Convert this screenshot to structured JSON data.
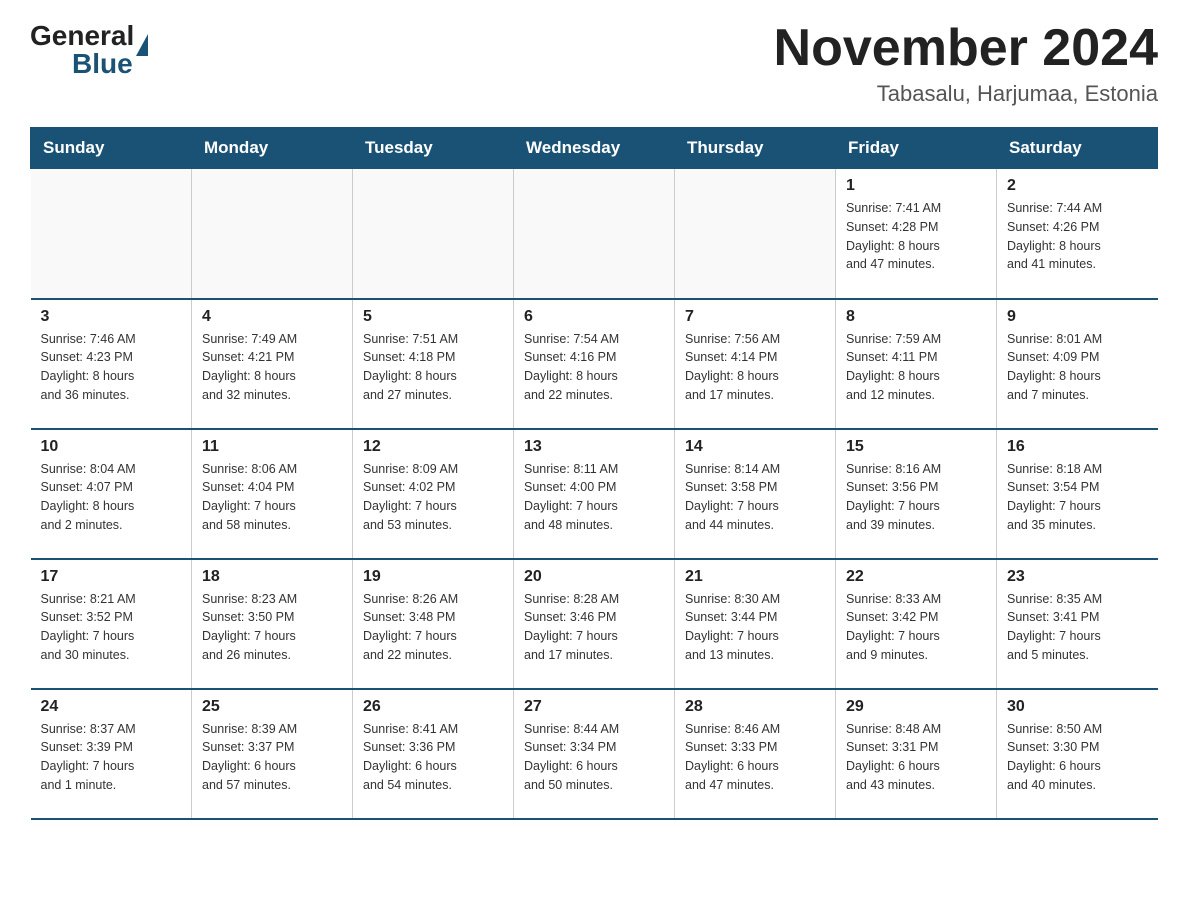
{
  "logo": {
    "text_general": "General",
    "text_blue": "Blue"
  },
  "title": "November 2024",
  "subtitle": "Tabasalu, Harjumaa, Estonia",
  "days_of_week": [
    "Sunday",
    "Monday",
    "Tuesday",
    "Wednesday",
    "Thursday",
    "Friday",
    "Saturday"
  ],
  "weeks": [
    [
      {
        "num": "",
        "info": ""
      },
      {
        "num": "",
        "info": ""
      },
      {
        "num": "",
        "info": ""
      },
      {
        "num": "",
        "info": ""
      },
      {
        "num": "",
        "info": ""
      },
      {
        "num": "1",
        "info": "Sunrise: 7:41 AM\nSunset: 4:28 PM\nDaylight: 8 hours\nand 47 minutes."
      },
      {
        "num": "2",
        "info": "Sunrise: 7:44 AM\nSunset: 4:26 PM\nDaylight: 8 hours\nand 41 minutes."
      }
    ],
    [
      {
        "num": "3",
        "info": "Sunrise: 7:46 AM\nSunset: 4:23 PM\nDaylight: 8 hours\nand 36 minutes."
      },
      {
        "num": "4",
        "info": "Sunrise: 7:49 AM\nSunset: 4:21 PM\nDaylight: 8 hours\nand 32 minutes."
      },
      {
        "num": "5",
        "info": "Sunrise: 7:51 AM\nSunset: 4:18 PM\nDaylight: 8 hours\nand 27 minutes."
      },
      {
        "num": "6",
        "info": "Sunrise: 7:54 AM\nSunset: 4:16 PM\nDaylight: 8 hours\nand 22 minutes."
      },
      {
        "num": "7",
        "info": "Sunrise: 7:56 AM\nSunset: 4:14 PM\nDaylight: 8 hours\nand 17 minutes."
      },
      {
        "num": "8",
        "info": "Sunrise: 7:59 AM\nSunset: 4:11 PM\nDaylight: 8 hours\nand 12 minutes."
      },
      {
        "num": "9",
        "info": "Sunrise: 8:01 AM\nSunset: 4:09 PM\nDaylight: 8 hours\nand 7 minutes."
      }
    ],
    [
      {
        "num": "10",
        "info": "Sunrise: 8:04 AM\nSunset: 4:07 PM\nDaylight: 8 hours\nand 2 minutes."
      },
      {
        "num": "11",
        "info": "Sunrise: 8:06 AM\nSunset: 4:04 PM\nDaylight: 7 hours\nand 58 minutes."
      },
      {
        "num": "12",
        "info": "Sunrise: 8:09 AM\nSunset: 4:02 PM\nDaylight: 7 hours\nand 53 minutes."
      },
      {
        "num": "13",
        "info": "Sunrise: 8:11 AM\nSunset: 4:00 PM\nDaylight: 7 hours\nand 48 minutes."
      },
      {
        "num": "14",
        "info": "Sunrise: 8:14 AM\nSunset: 3:58 PM\nDaylight: 7 hours\nand 44 minutes."
      },
      {
        "num": "15",
        "info": "Sunrise: 8:16 AM\nSunset: 3:56 PM\nDaylight: 7 hours\nand 39 minutes."
      },
      {
        "num": "16",
        "info": "Sunrise: 8:18 AM\nSunset: 3:54 PM\nDaylight: 7 hours\nand 35 minutes."
      }
    ],
    [
      {
        "num": "17",
        "info": "Sunrise: 8:21 AM\nSunset: 3:52 PM\nDaylight: 7 hours\nand 30 minutes."
      },
      {
        "num": "18",
        "info": "Sunrise: 8:23 AM\nSunset: 3:50 PM\nDaylight: 7 hours\nand 26 minutes."
      },
      {
        "num": "19",
        "info": "Sunrise: 8:26 AM\nSunset: 3:48 PM\nDaylight: 7 hours\nand 22 minutes."
      },
      {
        "num": "20",
        "info": "Sunrise: 8:28 AM\nSunset: 3:46 PM\nDaylight: 7 hours\nand 17 minutes."
      },
      {
        "num": "21",
        "info": "Sunrise: 8:30 AM\nSunset: 3:44 PM\nDaylight: 7 hours\nand 13 minutes."
      },
      {
        "num": "22",
        "info": "Sunrise: 8:33 AM\nSunset: 3:42 PM\nDaylight: 7 hours\nand 9 minutes."
      },
      {
        "num": "23",
        "info": "Sunrise: 8:35 AM\nSunset: 3:41 PM\nDaylight: 7 hours\nand 5 minutes."
      }
    ],
    [
      {
        "num": "24",
        "info": "Sunrise: 8:37 AM\nSunset: 3:39 PM\nDaylight: 7 hours\nand 1 minute."
      },
      {
        "num": "25",
        "info": "Sunrise: 8:39 AM\nSunset: 3:37 PM\nDaylight: 6 hours\nand 57 minutes."
      },
      {
        "num": "26",
        "info": "Sunrise: 8:41 AM\nSunset: 3:36 PM\nDaylight: 6 hours\nand 54 minutes."
      },
      {
        "num": "27",
        "info": "Sunrise: 8:44 AM\nSunset: 3:34 PM\nDaylight: 6 hours\nand 50 minutes."
      },
      {
        "num": "28",
        "info": "Sunrise: 8:46 AM\nSunset: 3:33 PM\nDaylight: 6 hours\nand 47 minutes."
      },
      {
        "num": "29",
        "info": "Sunrise: 8:48 AM\nSunset: 3:31 PM\nDaylight: 6 hours\nand 43 minutes."
      },
      {
        "num": "30",
        "info": "Sunrise: 8:50 AM\nSunset: 3:30 PM\nDaylight: 6 hours\nand 40 minutes."
      }
    ]
  ]
}
